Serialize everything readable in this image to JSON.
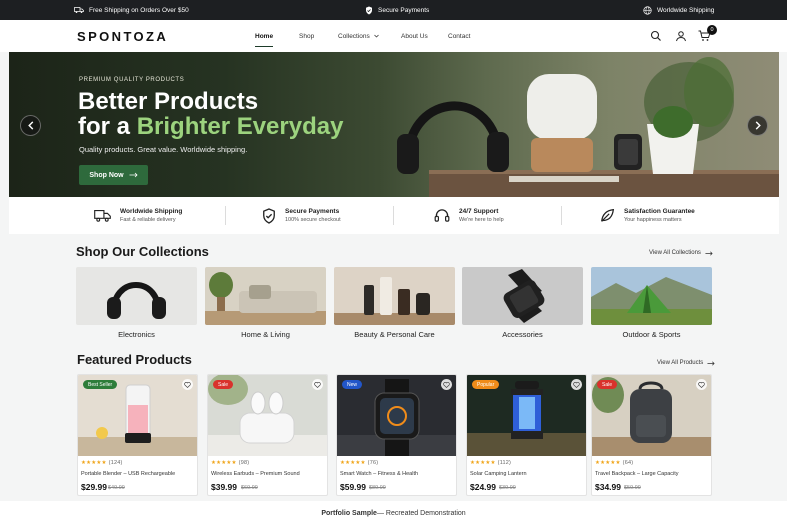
{
  "topbar": {
    "shipping": "Free Shipping on Orders Over $50",
    "secure": "Secure Payments",
    "worldwide": "Worldwide Shipping"
  },
  "header": {
    "logo": "SPONTOZA",
    "nav": [
      "Home",
      "Shop",
      "Collections",
      "About Us",
      "Contact"
    ],
    "active_nav": "Home",
    "cart_count": "0",
    "icons": [
      "search-icon",
      "user-icon",
      "cart-icon"
    ]
  },
  "hero": {
    "eyebrow": "PREMIUM QUALITY PRODUCTS",
    "title_line1": "Better Products",
    "title_line2_prefix": "for a ",
    "title_line2_accent": "Brighter Everyday",
    "subtitle": "Quality products. Great value. Worldwide shipping.",
    "cta": "Shop Now"
  },
  "features": [
    {
      "icon": "truck-icon",
      "title": "Worldwide Shipping",
      "sub": "Fast & reliable delivery"
    },
    {
      "icon": "shield-icon",
      "title": "Secure Payments",
      "sub": "100% secure checkout"
    },
    {
      "icon": "headset-icon",
      "title": "24/7 Support",
      "sub": "We're here to help"
    },
    {
      "icon": "leaf-icon",
      "title": "Satisfaction Guarantee",
      "sub": "Your happiness matters"
    }
  ],
  "collections": {
    "title": "Shop Our Collections",
    "view_all": "View All Collections",
    "items": [
      "Electronics",
      "Home & Living",
      "Beauty & Personal Care",
      "Accessories",
      "Outdoor & Sports"
    ]
  },
  "featured": {
    "title": "Featured Products",
    "view_all": "View All Products",
    "products": [
      {
        "badge": "Best Seller",
        "badge_color": "#2e7d3a",
        "stars": "★★★★★",
        "reviews": "(124)",
        "name": "Portable Blender – USB Rechargeable",
        "price": "$29.99",
        "old_price": "$49.99"
      },
      {
        "badge": "Sale",
        "badge_color": "#d9322c",
        "stars": "★★★★★",
        "reviews": "(98)",
        "name": "Wireless Earbuds – Premium Sound",
        "price": "$39.99",
        "old_price": "$69.99"
      },
      {
        "badge": "New",
        "badge_color": "#2256c9",
        "stars": "★★★★★",
        "reviews": "(76)",
        "name": "Smart Watch – Fitness & Health",
        "price": "$59.99",
        "old_price": "$89.99"
      },
      {
        "badge": "Popular",
        "badge_color": "#f08c1a",
        "stars": "★★★★★",
        "reviews": "(112)",
        "name": "Solar Camping Lantern",
        "price": "$24.99",
        "old_price": "$39.99"
      },
      {
        "badge": "Sale",
        "badge_color": "#d9322c",
        "stars": "★★★★★",
        "reviews": "(64)",
        "name": "Travel Backpack – Large Capacity",
        "price": "$34.99",
        "old_price": "$59.99"
      }
    ]
  },
  "footer": {
    "text_bold": "Portfolio Sample",
    "text_rest": " — Recreated Demonstration"
  }
}
